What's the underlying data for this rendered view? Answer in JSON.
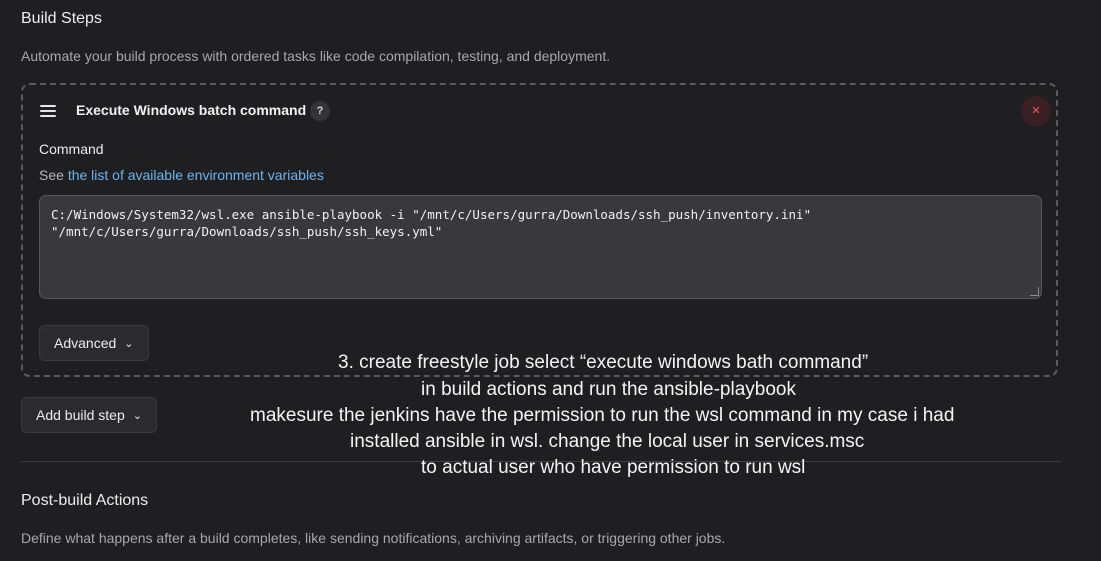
{
  "build_steps": {
    "title": "Build Steps",
    "description": "Automate your build process with ordered tasks like code compilation, testing, and deployment."
  },
  "step": {
    "title": "Execute Windows batch command",
    "help_label": "?",
    "close_label": "×",
    "command_label": "Command",
    "see_prefix": "See ",
    "env_link": "the list of available environment variables",
    "command_value": "C:/Windows/System32/wsl.exe ansible-playbook -i \"/mnt/c/Users/gurra/Downloads/ssh_push/inventory.ini\"\n\"/mnt/c/Users/gurra/Downloads/ssh_push/ssh_keys.yml\"",
    "advanced_label": "Advanced"
  },
  "add_step_label": "Add build step",
  "post_build": {
    "title": "Post-build Actions",
    "description": "Define what happens after a build completes, like sending notifications, archiving artifacts, or triggering other jobs."
  },
  "annotation": {
    "lines": [
      "3. create freestyle job select “execute windows bath command”",
      "in build actions and run the ansible-playbook",
      "makesure the jenkins have the permission to run the wsl command in my case i had",
      "installed ansible in wsl. change the local user in services.msc",
      "to actual user who have permission to run wsl"
    ]
  },
  "colors": {
    "background": "#1f1f21",
    "link": "#6cb4f0",
    "close_accent": "#f0565a"
  }
}
